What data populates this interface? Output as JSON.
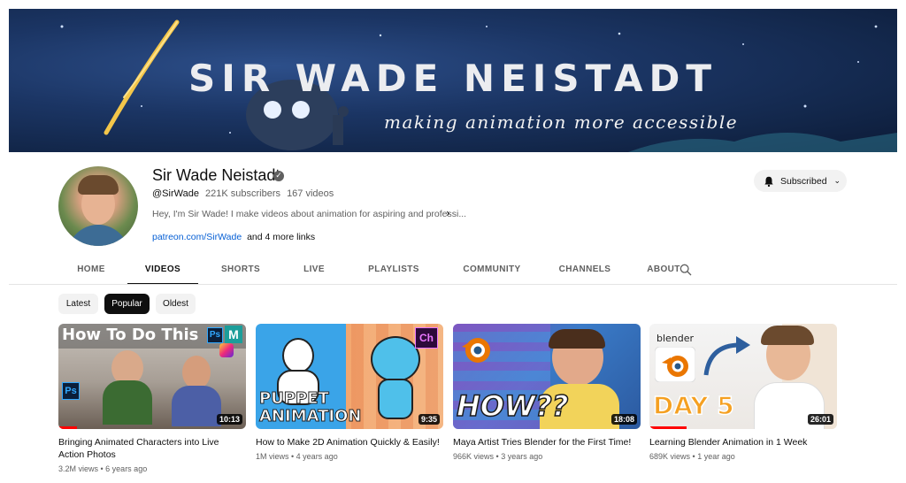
{
  "banner": {
    "title": "SIR WADE NEISTADT",
    "tagline": "making animation more accessible"
  },
  "channel": {
    "name": "Sir Wade Neistadt",
    "handle": "@SirWade",
    "subscribers": "221K subscribers",
    "videos": "167 videos",
    "description": "Hey, I'm Sir Wade! I make videos about animation for aspiring and professi...",
    "link": "patreon.com/SirWade",
    "more_links": "and 4 more links",
    "subscribe_label": "Subscribed"
  },
  "tabs": [
    "HOME",
    "VIDEOS",
    "SHORTS",
    "LIVE",
    "PLAYLISTS",
    "COMMUNITY",
    "CHANNELS",
    "ABOUT"
  ],
  "active_tab": "VIDEOS",
  "chips": [
    "Latest",
    "Popular",
    "Oldest"
  ],
  "active_chip": "Popular",
  "videos": [
    {
      "title": "Bringing Animated Characters into Live Action Photos",
      "views": "3.2M views",
      "age": "6 years ago",
      "duration": "10:13",
      "thumb_text": "How To Do This",
      "progress": 0.1
    },
    {
      "title": "How to Make 2D Animation Quickly & Easily!",
      "views": "1M views",
      "age": "4 years ago",
      "duration": "9:35",
      "thumb_text_1": "PUPPET",
      "thumb_text_2": "ANIMATION",
      "progress": 0
    },
    {
      "title": "Maya Artist Tries Blender for the First Time!",
      "views": "966K views",
      "age": "3 years ago",
      "duration": "18:08",
      "thumb_text": "HOW??",
      "progress": 0
    },
    {
      "title": "Learning Blender Animation in 1 Week",
      "views": "689K views",
      "age": "1 year ago",
      "duration": "26:01",
      "thumb_text": "DAY 5",
      "thumb_logo": "blender",
      "progress": 0.2
    }
  ],
  "colors": {
    "banner_bg": "#1b3564",
    "link": "#065fd4",
    "progress": "#ff0000"
  }
}
